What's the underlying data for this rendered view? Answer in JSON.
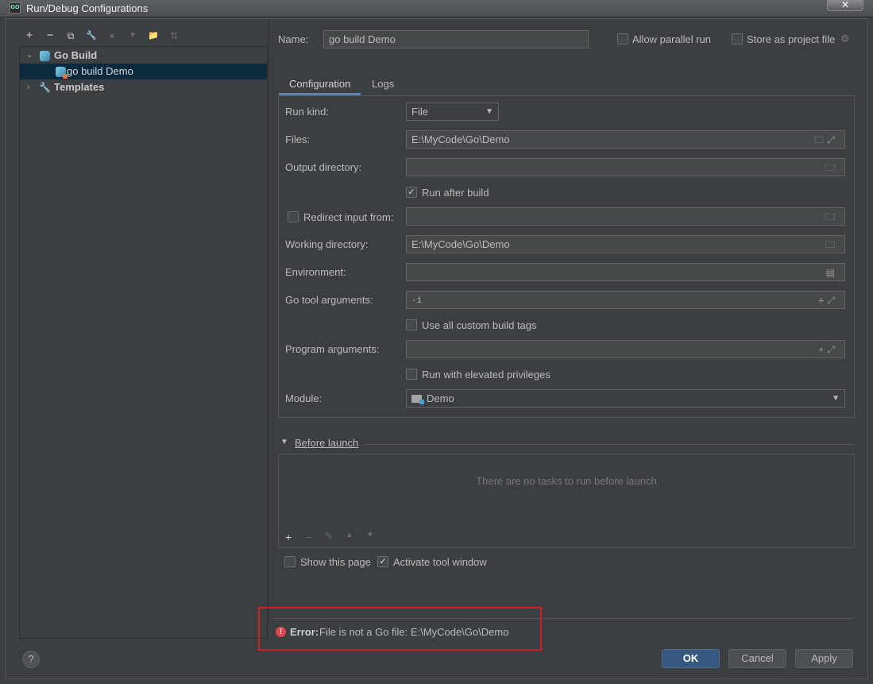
{
  "window": {
    "title": "Run/Debug Configurations",
    "close_glyph": "✕"
  },
  "toolbar": {
    "add": "+",
    "remove": "−",
    "copy": "⧉",
    "edit": "🔧",
    "up": "▲",
    "down": "▼",
    "folder": "📁",
    "sort": "⇅"
  },
  "tree": {
    "group_label": "Go Build",
    "config_label": "go build Demo",
    "templates_label": "Templates"
  },
  "name": {
    "label": "Name:",
    "value": "go build Demo"
  },
  "options": {
    "allow_parallel": "Allow parallel run",
    "store_as_project": "Store as project file"
  },
  "tabs": [
    "Configuration",
    "Logs"
  ],
  "config": {
    "run_kind_label": "Run kind:",
    "run_kind_value": "File",
    "files_label": "Files:",
    "files_value": "E:\\MyCode\\Go\\Demo",
    "output_dir_label": "Output directory:",
    "output_dir_value": "",
    "run_after_build": "Run after build",
    "redirect_input_label": "Redirect input from:",
    "redirect_input_value": "",
    "working_dir_label": "Working directory:",
    "working_dir_value": "E:\\MyCode\\Go\\Demo",
    "environment_label": "Environment:",
    "environment_value": "",
    "go_tool_args_label": "Go tool arguments:",
    "go_tool_args_value": "-i",
    "custom_build_tags": "Use all custom build tags",
    "program_args_label": "Program arguments:",
    "program_args_value": "",
    "elevated": "Run with elevated privileges",
    "module_label": "Module:",
    "module_value": "Demo"
  },
  "before_launch": {
    "label": "Before launch",
    "empty_text": "There are no tasks to run before launch"
  },
  "footer_options": {
    "show_page": "Show this page",
    "activate_tool": "Activate tool window"
  },
  "error": {
    "prefix": "Error:",
    "message": "File is not a Go file: E:\\MyCode\\Go\\Demo"
  },
  "buttons": {
    "ok": "OK",
    "cancel": "Cancel",
    "apply": "Apply",
    "help": "?"
  },
  "colors": {
    "accent": "#4a88c7",
    "error_border": "#d02020",
    "selection": "#0d293e",
    "primary_button": "#365880"
  }
}
